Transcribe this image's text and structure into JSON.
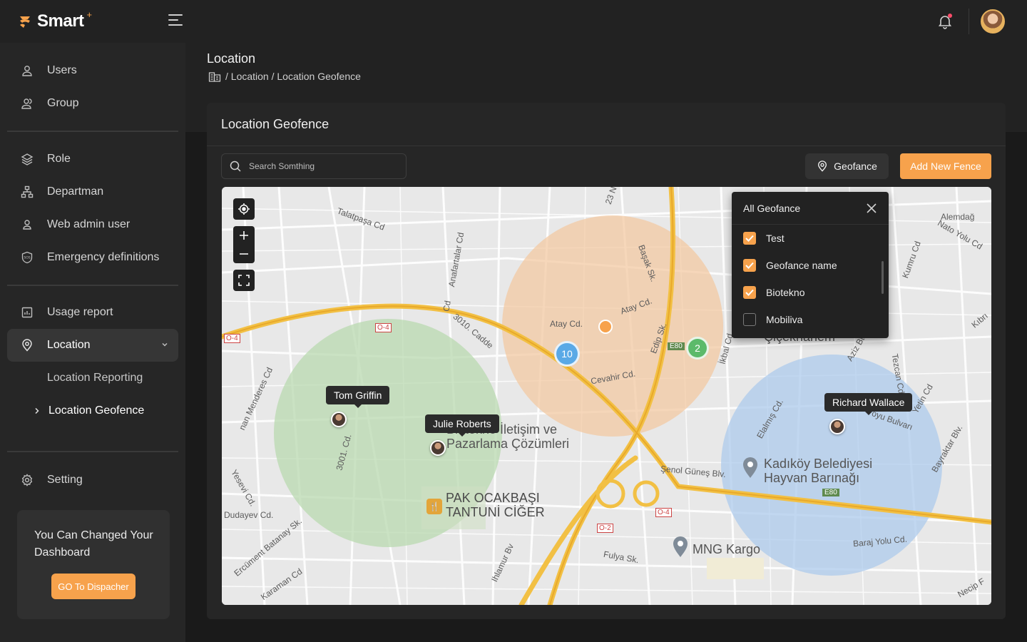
{
  "app": {
    "logo_text": "Smart",
    "logo_sup": "+"
  },
  "sidebar": {
    "items": [
      {
        "label": "Users",
        "icon": "user-icon"
      },
      {
        "label": "Group",
        "icon": "group-icon"
      },
      {
        "label": "Role",
        "icon": "layers-icon"
      },
      {
        "label": "Departman",
        "icon": "hierarchy-icon"
      },
      {
        "label": "Web admin user",
        "icon": "user-icon"
      },
      {
        "label": "Emergency definitions",
        "icon": "sos-shield-icon"
      },
      {
        "label": "Usage report",
        "icon": "report-icon"
      },
      {
        "label": "Location",
        "icon": "location-pin-icon"
      },
      {
        "label": "Setting",
        "icon": "gear-icon"
      }
    ],
    "sub_items": [
      {
        "label": "Location Reporting"
      },
      {
        "label": "Location Geofence"
      }
    ],
    "promo": {
      "text": "You Can Changed Your Dashboard",
      "button": "GO To Dispacher"
    }
  },
  "header": {
    "title": "Location",
    "breadcrumb": "/ Location / Location Geofence"
  },
  "card": {
    "title": "Location Geofence",
    "search_placeholder": "Search Somthing",
    "geofence_button": "Geofance",
    "add_button": "Add New Fence"
  },
  "map": {
    "people": [
      {
        "name": "Tom Griffin"
      },
      {
        "name": "Julie Roberts"
      },
      {
        "name": "Richard Wallace"
      }
    ],
    "clusters": [
      {
        "count": "10",
        "color": "#5aa9e6"
      },
      {
        "count": "2",
        "color": "#5cba6a"
      }
    ],
    "labels": {
      "talatpasa": "Talatpaşa Cd",
      "anafartalar": "Anafartalar Cd",
      "cadde3010": "3010. Cadde",
      "o4a": "O-4",
      "o4b": "O-4",
      "o4c": "O-4",
      "o2": "O-2",
      "e80a": "E80",
      "e80b": "E80",
      "atay1": "Atay Cd.",
      "atay2": "Atay Cd.",
      "basak": "Başak Sk.",
      "edip": "Edip Sk.",
      "cevahir": "Cevahir Cd.",
      "ikbal": "İkbal Cd",
      "elalmis": "Elalmış Cd.",
      "cd3001": "3001. Cd.",
      "menderes": "nan Menderes Cd",
      "yesevi": "Yesevi Cd.",
      "dudayev": "Dudayev Cd.",
      "ercument": "Ercüment Batanay Sk.",
      "karaman": "Karaman Cd",
      "ihlamur": "Ihlamur Bv",
      "fulya": "Fulya Sk.",
      "senol": "Şenol Güneş Blv.",
      "baraj": "Baraj Yolu Cd.",
      "bayraktar": "Bayraktar Blv.",
      "necip": "Necip F",
      "alemdag": "Alemdağ",
      "nato": "Nato Yolu Cd",
      "kumru": "Kumru Cd",
      "tezcan": "Tezcan Cd",
      "yetin": "Yetin Cd",
      "soyu": "oyu Bulvarı",
      "street23": "23 N",
      "cicekli": "Çiçekhanem",
      "aziz": "Aziz Bt",
      "kibri": "Kıbrı",
      "cd_mi": "Cd"
    },
    "pois": {
      "biotekno": "Biotekno İletişim ve Pazarlama Çözümleri",
      "pak": "PAK OCAKBAŞI TANTUNİ CİĞER",
      "kadikoy": "Kadıköy Belediyesi Hayvan Barınağı",
      "mng": "MNG Kargo"
    },
    "zones": [
      {
        "name": "green-zone",
        "color": "#b9d9b0"
      },
      {
        "name": "orange-zone",
        "color": "#f3c9a3"
      },
      {
        "name": "blue-zone",
        "color": "#aecbec"
      }
    ]
  },
  "geofence_panel": {
    "title": "All Geofance",
    "options": [
      {
        "label": "Test",
        "checked": true
      },
      {
        "label": "Geofance name",
        "checked": true
      },
      {
        "label": "Biotekno",
        "checked": true
      },
      {
        "label": "Mobiliva",
        "checked": false
      }
    ]
  },
  "colors": {
    "accent": "#f7a24c",
    "bg": "#1a1a1a",
    "panel": "#262626"
  }
}
